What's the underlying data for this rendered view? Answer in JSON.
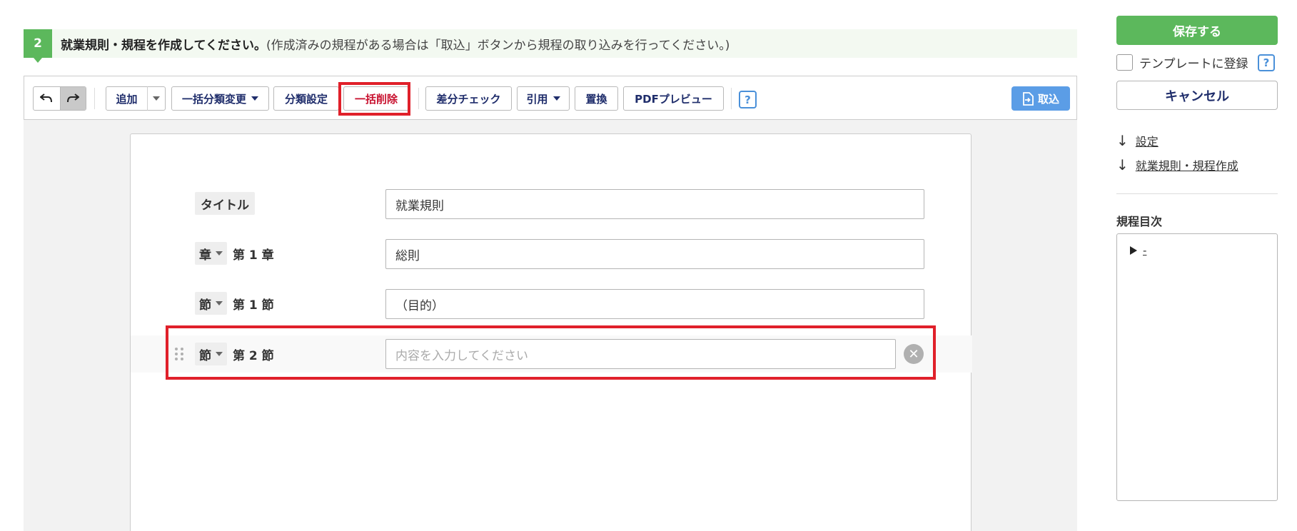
{
  "step": {
    "number": "2",
    "title": "就業規則・規程を作成してください。",
    "note": "(作成済みの規程がある場合は「取込」ボタンから規程の取り込みを行ってください。)"
  },
  "toolbar": {
    "undo_icon": "undo-icon",
    "redo_icon": "redo-icon",
    "add": "追加",
    "bulk_category_change": "一括分類変更",
    "category_settings": "分類設定",
    "bulk_delete": "一括削除",
    "diff_check": "差分チェック",
    "quote": "引用",
    "replace": "置換",
    "pdf_preview": "PDFプレビュー",
    "help": "?",
    "import": "取込"
  },
  "document": {
    "title_label": "タイトル",
    "title_value": "就業規則",
    "rows": [
      {
        "type": "章",
        "number": "第 1 章",
        "value": "総則",
        "placeholder": ""
      },
      {
        "type": "節",
        "number": "第 1 節",
        "value": "（目的）",
        "placeholder": ""
      },
      {
        "type": "節",
        "number": "第 2 節",
        "value": "",
        "placeholder": "内容を入力してください"
      }
    ]
  },
  "sidebar": {
    "save": "保存する",
    "template_register": "テンプレートに登録",
    "template_help": "?",
    "cancel": "キャンセル",
    "links": [
      "設定",
      "就業規則・規程作成"
    ],
    "toc_title": "規程目次",
    "toc_items": [
      "-"
    ]
  },
  "colors": {
    "green": "#5cb85c",
    "highlight_red": "#e0202a",
    "import_blue": "#5b9de6",
    "navy_text": "#1f2d6b"
  }
}
